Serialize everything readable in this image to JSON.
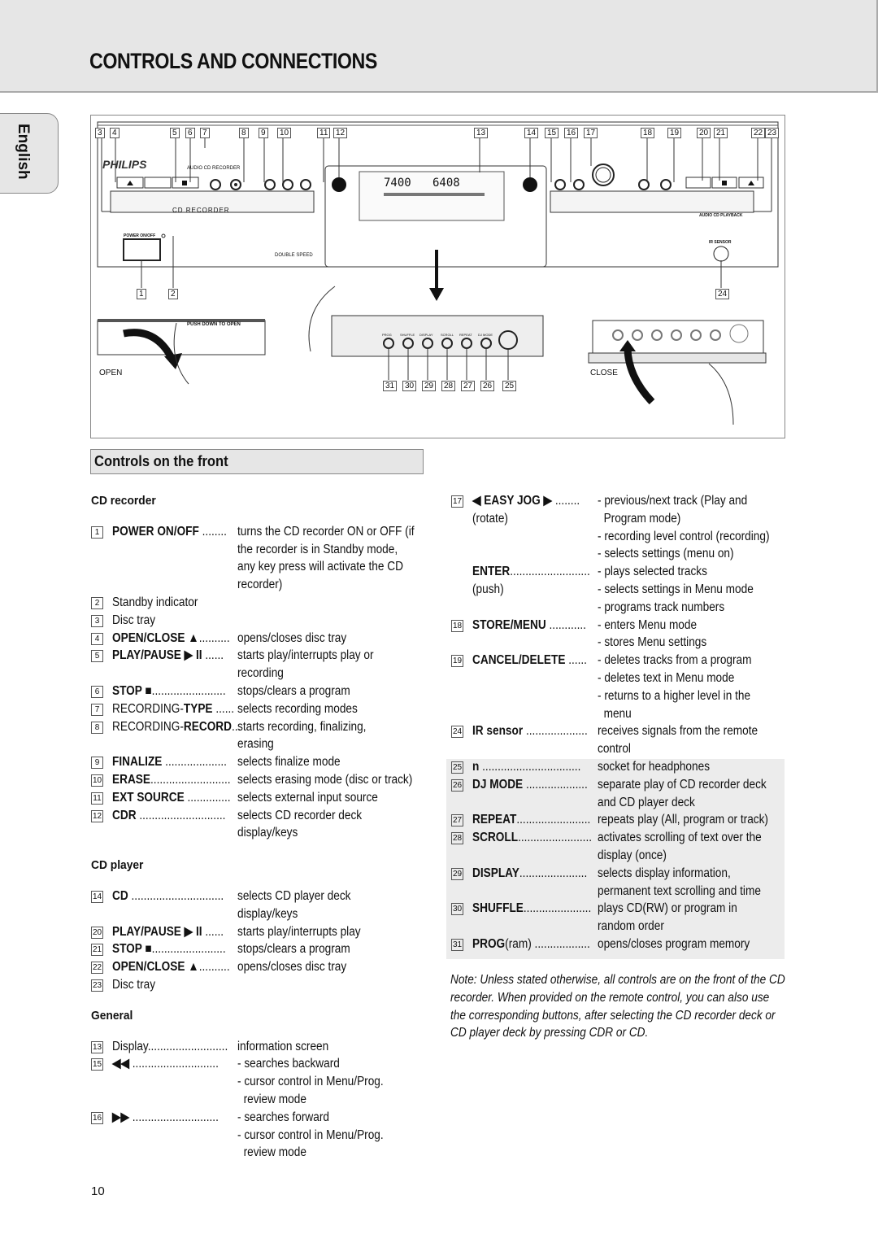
{
  "header": {
    "title": "CONTROLS AND CONNECTIONS"
  },
  "language_tab": "English",
  "figure": {
    "brand": "PHILIPS",
    "device_label": "AUDIO CD RECORDER",
    "tray_label_left": "CD RECORDER",
    "tray_label_right": "AUDIO CD PLAYBACK",
    "power_label": "POWER ON/OFF",
    "double_speed": "DOUBLE SPEED",
    "ir_sensor": "IR SENSOR",
    "display_time_left": "7400",
    "display_time_right": "6408",
    "push_down": "PUSH DOWN TO OPEN",
    "open_label": "OPEN",
    "close_label": "CLOSE",
    "button_labels": [
      "OPEN/CLOSE",
      "PLAY/PAUSE",
      "STOP",
      "TYPE",
      "RECORDING",
      "RECORD",
      "FINALIZE",
      "ERASE",
      "EXT SOURCE",
      "CDR",
      "CD",
      "EASY JOG",
      "ENTER",
      "STORE/MENU",
      "CANCEL/DELETE",
      "PLAY/PAUSE",
      "STOP",
      "OPEN/CLOSE"
    ],
    "panel_labels": [
      "PROG",
      "SHUFFLE",
      "DISPLAY",
      "SCROLL",
      "REPEAT",
      "DJ MODE"
    ],
    "top_callouts": [
      "3",
      "4",
      "5",
      "6",
      "7",
      "8",
      "9",
      "10",
      "11",
      "12",
      "13",
      "14",
      "15",
      "16",
      "17",
      "18",
      "19",
      "20",
      "21",
      "22",
      "23"
    ],
    "bottom_callouts": [
      "1",
      "2",
      "24"
    ],
    "panel_callouts": [
      "31",
      "30",
      "29",
      "28",
      "27",
      "26",
      "25"
    ]
  },
  "section": {
    "title": "Controls on the front"
  },
  "left_column": {
    "cd_recorder_heading": "CD recorder",
    "cd_player_heading": "CD player",
    "general_heading": "General",
    "cd_recorder_items": [
      {
        "num": "1",
        "name": "POWER ON/OFF",
        "dots": " ........",
        "desc": [
          "turns the CD recorder ON or OFF (if",
          "the recorder is in Standby mode,",
          "any key press will activate the CD",
          "recorder)"
        ]
      },
      {
        "num": "2",
        "name": "Standby indicator",
        "dots": "",
        "desc": []
      },
      {
        "num": "3",
        "name": "Disc tray",
        "dots": "",
        "desc": []
      },
      {
        "num": "4",
        "name": "OPEN/CLOSE ▲",
        "dots": "..........",
        "desc": [
          "opens/closes disc tray"
        ]
      },
      {
        "num": "5",
        "name": "PLAY/PAUSE ▶ II",
        "dots": " ......",
        "desc": [
          "starts play/interrupts play or",
          "recording"
        ]
      },
      {
        "num": "6",
        "name": "STOP ■",
        "dots": "........................",
        "desc": [
          "stops/clears a program"
        ]
      },
      {
        "num": "7",
        "name": "RECORDING-TYPE",
        "dots": " ......",
        "desc": [
          "selects recording modes"
        ]
      },
      {
        "num": "8",
        "name": "RECORDING-RECORD",
        "dots": "...",
        "desc": [
          "starts recording, finalizing,",
          "erasing"
        ]
      },
      {
        "num": "9",
        "name": "FINALIZE",
        "dots": " ....................",
        "desc": [
          "selects finalize mode"
        ]
      },
      {
        "num": "10",
        "name": "ERASE",
        "dots": "..........................",
        "desc": [
          "selects erasing mode (disc or track)"
        ]
      },
      {
        "num": "11",
        "name": "EXT SOURCE",
        "dots": " ..............",
        "desc": [
          "selects external input source"
        ]
      },
      {
        "num": "12",
        "name": "CDR",
        "dots": " ............................",
        "desc": [
          "selects CD recorder deck",
          "display/keys"
        ]
      }
    ],
    "cd_player_items": [
      {
        "num": "14",
        "name": "CD",
        "dots": " ..............................",
        "desc": [
          "selects CD player deck",
          "display/keys"
        ]
      },
      {
        "num": "20",
        "name": "PLAY/PAUSE ▶ II",
        "dots": " ......",
        "desc": [
          "starts play/interrupts play"
        ]
      },
      {
        "num": "21",
        "name": "STOP ■",
        "dots": "........................",
        "desc": [
          "stops/clears a program"
        ]
      },
      {
        "num": "22",
        "name": "OPEN/CLOSE ▲",
        "dots": "..........",
        "desc": [
          "opens/closes disc tray"
        ]
      },
      {
        "num": "23",
        "name": "Disc tray",
        "dots": "",
        "desc": []
      }
    ],
    "general_items": [
      {
        "num": "13",
        "name": "Display",
        "dots": "..........................",
        "desc": [
          "information screen"
        ]
      },
      {
        "num": "15",
        "name": "◀◀",
        "dots": " ............................",
        "desc": [
          "- searches backward",
          "- cursor control in Menu/Prog.",
          "  review mode"
        ]
      },
      {
        "num": "16",
        "name": "▶▶",
        "dots": " ............................",
        "desc": [
          "- searches forward",
          "- cursor control in Menu/Prog.",
          "  review mode"
        ]
      }
    ]
  },
  "right_column": {
    "items": [
      {
        "num": "17",
        "name": "◀ EASY JOG ▶",
        "dots": " ........",
        "sub": "(rotate)",
        "desc": [
          "- previous/next track (Play and",
          "  Program mode)",
          "- recording level control (recording)",
          "- selects settings (menu on)"
        ]
      },
      {
        "num": "",
        "name": "ENTER",
        "dots": "..........................",
        "sub": "(push)",
        "desc": [
          "- plays selected tracks",
          "- selects settings in Menu mode",
          "- programs track numbers"
        ]
      },
      {
        "num": "18",
        "name": "STORE/MENU",
        "dots": " ............",
        "desc": [
          "- enters Menu mode",
          "- stores Menu settings"
        ]
      },
      {
        "num": "19",
        "name": "CANCEL/DELETE",
        "dots": " ......",
        "desc": [
          "- deletes tracks from a program",
          "- deletes text in Menu mode",
          "- returns to a higher level in the",
          "  menu"
        ]
      },
      {
        "num": "24",
        "name": "IR sensor",
        "dots": " ....................",
        "desc": [
          "receives signals from the remote",
          "control"
        ]
      },
      {
        "num": "25",
        "name": "n",
        "dots": " ................................",
        "desc": [
          "socket for headphones"
        ]
      },
      {
        "num": "26",
        "name": "DJ MODE",
        "dots": " ....................",
        "desc": [
          "separate play of CD recorder deck",
          "and CD player deck"
        ]
      },
      {
        "num": "27",
        "name": "REPEAT",
        "dots": "........................",
        "desc": [
          "repeats play (All, program or track)"
        ]
      },
      {
        "num": "28",
        "name": "SCROLL",
        "dots": "........................",
        "desc": [
          "activates scrolling of text over the",
          "display (once)"
        ]
      },
      {
        "num": "29",
        "name": "DISPLAY",
        "dots": "......................",
        "desc": [
          "selects display information,",
          "permanent text scrolling and time"
        ]
      },
      {
        "num": "30",
        "name": "SHUFFLE",
        "dots": "......................",
        "desc": [
          "plays CD(RW) or program in",
          "random order"
        ]
      },
      {
        "num": "31",
        "name": "PROG",
        "name_suffix": "(ram)",
        "dots": " ..................",
        "desc": [
          "opens/closes program memory"
        ]
      }
    ],
    "note": "Note: Unless stated otherwise, all controls are on the front of the CD recorder. When provided on the remote control, you can also use the corresponding buttons, after selecting the CD recorder deck or CD player deck by pressing CDR or CD."
  },
  "page_number": "10"
}
